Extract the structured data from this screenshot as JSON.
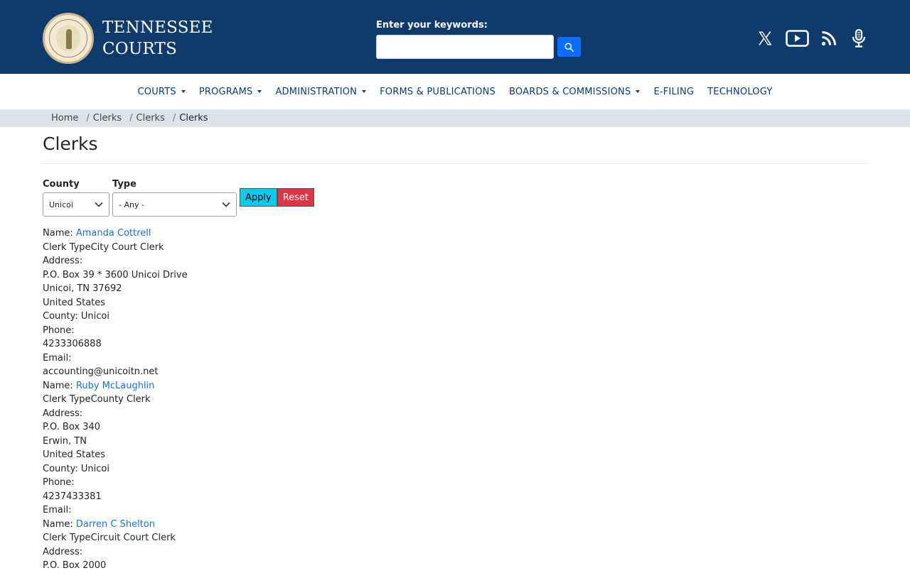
{
  "header": {
    "brand_line1": "TENNESSEE",
    "brand_line2": "COURTS",
    "search_label": "Enter your keywords:",
    "search_value": "",
    "social_icons": [
      "x-twitter-icon",
      "youtube-icon",
      "rss-icon",
      "podcast-microphone-icon"
    ]
  },
  "nav": {
    "items": [
      {
        "label": "COURTS",
        "dropdown": true
      },
      {
        "label": "PROGRAMS",
        "dropdown": true
      },
      {
        "label": "ADMINISTRATION",
        "dropdown": true
      },
      {
        "label": "FORMS & PUBLICATIONS",
        "dropdown": false
      },
      {
        "label": "BOARDS & COMMISSIONS",
        "dropdown": true
      },
      {
        "label": "E-FILING",
        "dropdown": false
      },
      {
        "label": "TECHNOLOGY",
        "dropdown": false
      }
    ]
  },
  "breadcrumb": {
    "items": [
      "Home",
      "Clerks",
      "Clerks",
      "Clerks"
    ]
  },
  "page": {
    "title": "Clerks"
  },
  "filters": {
    "county_label": "County",
    "county_value": "Unicoi",
    "type_label": "Type",
    "type_value": "- Any -",
    "apply_label": "Apply",
    "reset_label": "Reset"
  },
  "results": {
    "labels": {
      "name": "Name: ",
      "clerk_type": "Clerk Type",
      "address": "Address:",
      "county": "County: ",
      "phone": "Phone:",
      "email": "Email:"
    },
    "entries": [
      {
        "name": "Amanda Cottrell",
        "type": "City Court Clerk",
        "address_line1": "P.O. Box 39 * 3600 Unicoi Drive",
        "address_line2": "Unicoi, TN 37692",
        "country": "United States",
        "county": "Unicoi",
        "phone": "4233306888",
        "email": "accounting@unicoitn.net"
      },
      {
        "name": "Ruby McLaughlin",
        "type": "County Clerk",
        "address_line1": "P.O. Box 340",
        "address_line2": "Erwin, TN",
        "country": "United States",
        "county": "Unicoi",
        "phone": "4237433381",
        "email": ""
      },
      {
        "name": "Darren C Shelton",
        "type": "Circuit Court Clerk",
        "address_line1": "P.O. Box 2000"
      }
    ]
  },
  "colors": {
    "header_bg": "#0e3b6b",
    "nav_text": "#0e3b6b",
    "breadcrumb_bg": "#dde3e9",
    "link": "#1a6fd6",
    "apply_bg": "#0dcaf0",
    "reset_bg": "#dc3545",
    "search_btn": "#0d6efd"
  }
}
